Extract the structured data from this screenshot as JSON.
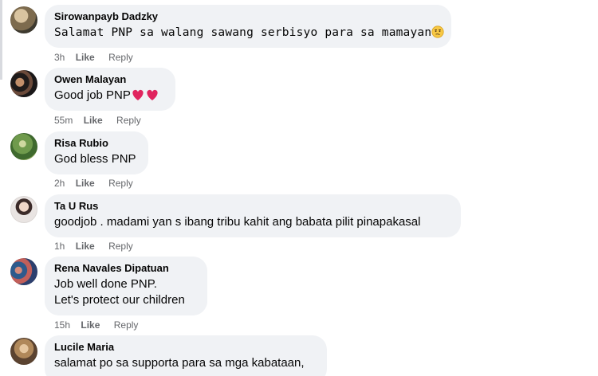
{
  "comments": [
    {
      "author": "Sirowanpayb Dadzky",
      "text": "Salamat PNP sa walang sawang serbisyo para sa mamayan",
      "time": "3h",
      "like": "Like",
      "reply": "Reply",
      "emoji": "thinking-emoji"
    },
    {
      "author": "Owen Malayan",
      "text": "Good job PNP",
      "time": "55m",
      "like": "Like",
      "reply": "Reply",
      "emoji": "two-red-hearts"
    },
    {
      "author": "Risa Rubio",
      "text": "God bless PNP",
      "time": "2h",
      "like": "Like",
      "reply": "Reply"
    },
    {
      "author": "Ta U Rus",
      "text": "goodjob . madami yan s ibang tribu kahit ang babata pilit pinapakasal",
      "time": "1h",
      "like": "Like",
      "reply": "Reply"
    },
    {
      "author": "Rena Navales Dipatuan",
      "text_lines": [
        "Job well done PNP.",
        "Let's protect our children"
      ],
      "time": "15h",
      "like": "Like",
      "reply": "Reply"
    },
    {
      "author": "Lucile Maria",
      "text": "salamat po sa supporta para sa mga kabataan,"
    }
  ],
  "colors": {
    "bubble": "#f0f2f5",
    "text": "#050505",
    "meta": "#65676b",
    "heart": "#e0245e"
  }
}
